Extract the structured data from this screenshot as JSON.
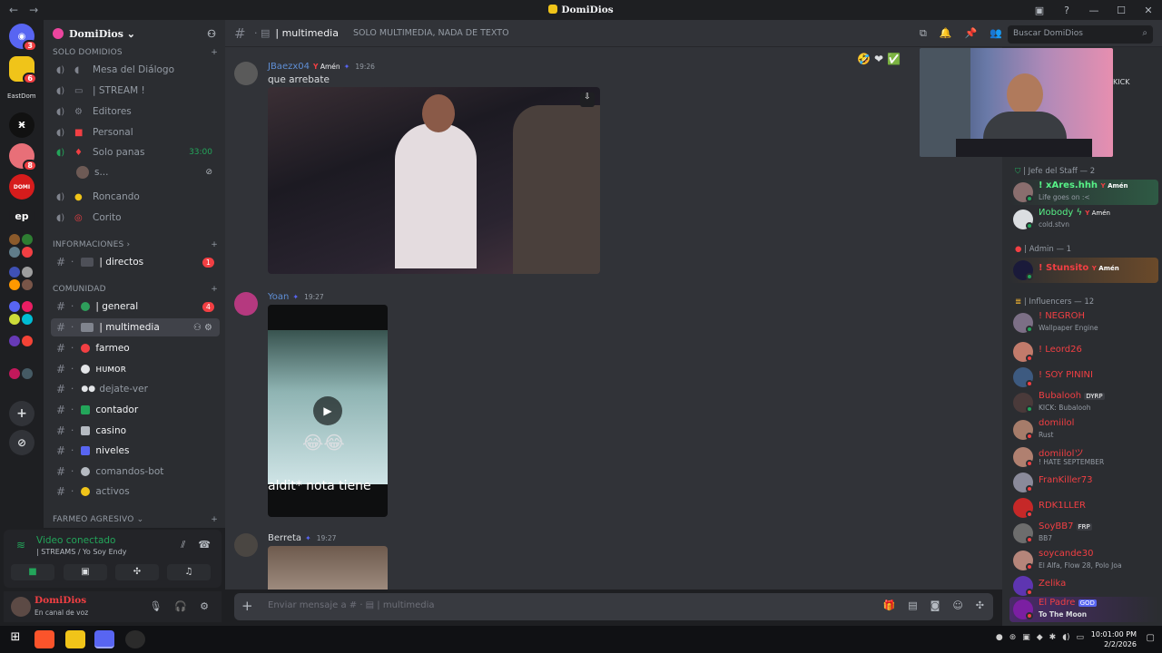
{
  "window": {
    "title": "DomiDios",
    "controls": [
      "—",
      "☐",
      "✕"
    ]
  },
  "guild": {
    "name": "DomiDios ⌄"
  },
  "servers": [
    {
      "label": "",
      "badge": "3"
    },
    {
      "label": "",
      "badge": "6"
    },
    {
      "label": "EastDom",
      "badge": ""
    },
    {
      "label": "",
      "badge": ""
    },
    {
      "label": "",
      "badge": "8"
    },
    {
      "label": "",
      "badge": ""
    },
    {
      "label": "ep",
      "badge": ""
    }
  ],
  "sidebar": {
    "categories": [
      {
        "name": "SOLO DOMIDIOS"
      },
      {
        "name": "INFORMACIONES ›"
      },
      {
        "name": "COMUNIDAD"
      },
      {
        "name": "FARMEO AGRESIVO ⌄"
      }
    ],
    "voice_channels": [
      {
        "label": "Mesa del Diálogo"
      },
      {
        "label": "| STREAM !"
      },
      {
        "label": "Editores"
      },
      {
        "label": "Personal"
      },
      {
        "label": "Solo panas",
        "time": "33:00"
      },
      {
        "label": "s..."
      },
      {
        "label": "Roncando"
      },
      {
        "label": "Corito"
      }
    ],
    "text_channels": [
      {
        "label": "| directos",
        "badge": "1"
      },
      {
        "label": "| general",
        "badge": "4"
      },
      {
        "label": "| multimedia"
      },
      {
        "label": "farmeo"
      },
      {
        "label": "ʜᴜᴍᴏʀ"
      },
      {
        "label": "dejate-ver"
      },
      {
        "label": "contador"
      },
      {
        "label": "casino"
      },
      {
        "label": "niveles"
      },
      {
        "label": "comandos-bot"
      },
      {
        "label": "activos"
      }
    ]
  },
  "voice_status": {
    "title": "Video conectado",
    "subtitle": "| STREAMS / Yo Soy Endy"
  },
  "user": {
    "name": "DomiDios",
    "status": "En canal de voz"
  },
  "channel": {
    "name": "| multimedia",
    "topic": "SOLO MULTIMEDIA, NADA DE TEXTO"
  },
  "search": {
    "placeholder": "Buscar DomiDios"
  },
  "messages": [
    {
      "author": "JBaezx04",
      "role": "Amén",
      "time": "19:26",
      "text": "que arrebate"
    },
    {
      "author": "Yoan",
      "time": "19:27",
      "video_caption": "aldit* nota tiene"
    },
    {
      "author": "Berreta",
      "time": "19:27"
    }
  ],
  "composer": {
    "placeholder": "Enviar mensaje a # · ▤ | multimedia"
  },
  "members": {
    "kick_tag": "KICK",
    "groups": [
      {
        "header": "| Jefe del Staff — 2"
      },
      {
        "header": "| Admin — 1"
      },
      {
        "header": "| Influencers — 12"
      }
    ],
    "list": [
      {
        "name": "! xAres.hhh",
        "role": "Amén",
        "status": "Life goes on :<"
      },
      {
        "name": "Иobody ϟ",
        "role": "Amén",
        "status": "cold.stvn"
      },
      {
        "name": "! Stunsito",
        "role": "Amén",
        "status": ""
      },
      {
        "name": "! NEGROH",
        "status": "Wallpaper Engine"
      },
      {
        "name": "! Leord26",
        "status": ""
      },
      {
        "name": "! SOY PININI",
        "status": ""
      },
      {
        "name": "Bubalooh",
        "role": "DYRP",
        "status": "KICK: Bubalooh"
      },
      {
        "name": "domiilol",
        "status": "Rust"
      },
      {
        "name": "domiilolツ",
        "status": "! HATE SEPTEMBER"
      },
      {
        "name": "FranKiller73",
        "status": ""
      },
      {
        "name": "RDK1LLER",
        "status": ""
      },
      {
        "name": "SoyBB7",
        "role": "FRP",
        "status": "BB7"
      },
      {
        "name": "soycande30",
        "status": "El Alfa, Flow 28, Polo Joa"
      },
      {
        "name": "Zelika",
        "status": ""
      },
      {
        "name": "El Padre",
        "role": "GOD",
        "status": "To The Moon"
      }
    ]
  },
  "taskbar": {
    "time": "10:01:00 PM",
    "date": "2/2/2026"
  },
  "colors": {
    "bg": "#313338",
    "sidebar": "#2b2d31",
    "accent_red": "#f23f43",
    "accent_green": "#23a55a",
    "blurple": "#5865f2"
  }
}
